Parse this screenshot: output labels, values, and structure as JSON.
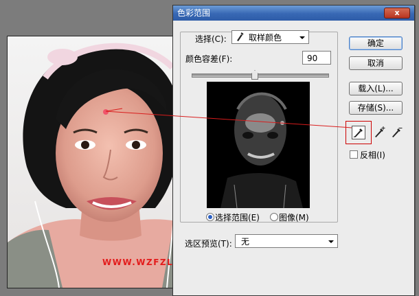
{
  "dialog": {
    "title": "色彩范围",
    "close_label": "x"
  },
  "select": {
    "label": "选择(C):",
    "value": "取样颜色"
  },
  "fuzziness": {
    "label": "颜色容差(F):",
    "value": "90",
    "level_fraction": 0.46
  },
  "view": {
    "selection_label": "选择范围(E)",
    "image_label": "图像(M)",
    "selected": "selection"
  },
  "selection_preview": {
    "label": "选区预览(T):",
    "value": "无"
  },
  "buttons": {
    "ok": "确定",
    "cancel": "取消",
    "load": "载入(L)...",
    "save": "存储(S)..."
  },
  "tools": {
    "eyedropper": "eyedropper-icon",
    "eyedropper_plus": "eyedropper-plus-icon",
    "eyedropper_minus": "eyedropper-minus-icon",
    "active": "eyedropper"
  },
  "invert": {
    "label": "反相(I)",
    "checked": false
  },
  "watermark": "WWW.WZFZL.CN",
  "colors": {
    "annotation": "#d91c1c",
    "title_bar": "#3868b4",
    "dialog_bg": "#ececec"
  }
}
